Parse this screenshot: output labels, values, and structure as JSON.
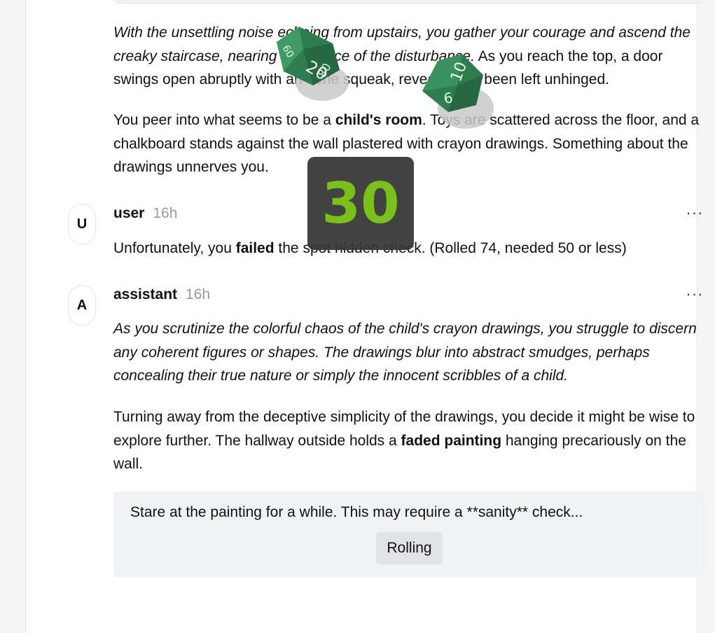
{
  "messages": [
    {
      "role": "assistant",
      "paragraphs": [
        {
          "italic": "With the unsettling noise echoing from upstairs, you gather your courage and ascend the creaky staircase, nearing the source of the disturbance.",
          "text": " As you reach the top, a door swings open abruptly with an eerie squeak, revealing it's been left unhinged."
        },
        {
          "before": "You peer into what seems to be a ",
          "bold": "child's room",
          "after": ". Toys are scattered across the floor, and a chalkboard stands against the wall plastered with crayon drawings. Something about the drawings unnerves you."
        }
      ]
    },
    {
      "avatar": "U",
      "author": "user",
      "time": "16h",
      "before": "Unfortunately, you ",
      "bold": "failed",
      "after": " the spot hidden check. (Rolled 74, needed 50 or less)"
    },
    {
      "avatar": "A",
      "author": "assistant",
      "time": "16h",
      "italic": "As you scrutinize the colorful chaos of the child's crayon drawings, you struggle to discern any coherent figures or shapes. The drawings blur into abstract smudges, perhaps concealing their true nature or simply the innocent scribbles of a child.",
      "before": "Turning away from the deceptive simplicity of the drawings, you decide it might be wise to explore further. The hallway outside holds a ",
      "bold": "faded painting",
      "after": " hanging precariously on the wall."
    }
  ],
  "more_label": "···",
  "action": {
    "prompt": "Stare at the painting for a while. This may require a **sanity** check...",
    "button": "Rolling"
  },
  "dice": {
    "result": "30",
    "result_color": "#7ac11c",
    "die_color": "#2e7d4f",
    "die1_faces": [
      "20",
      "80",
      "60"
    ],
    "die2_faces": [
      "10",
      "6"
    ]
  }
}
